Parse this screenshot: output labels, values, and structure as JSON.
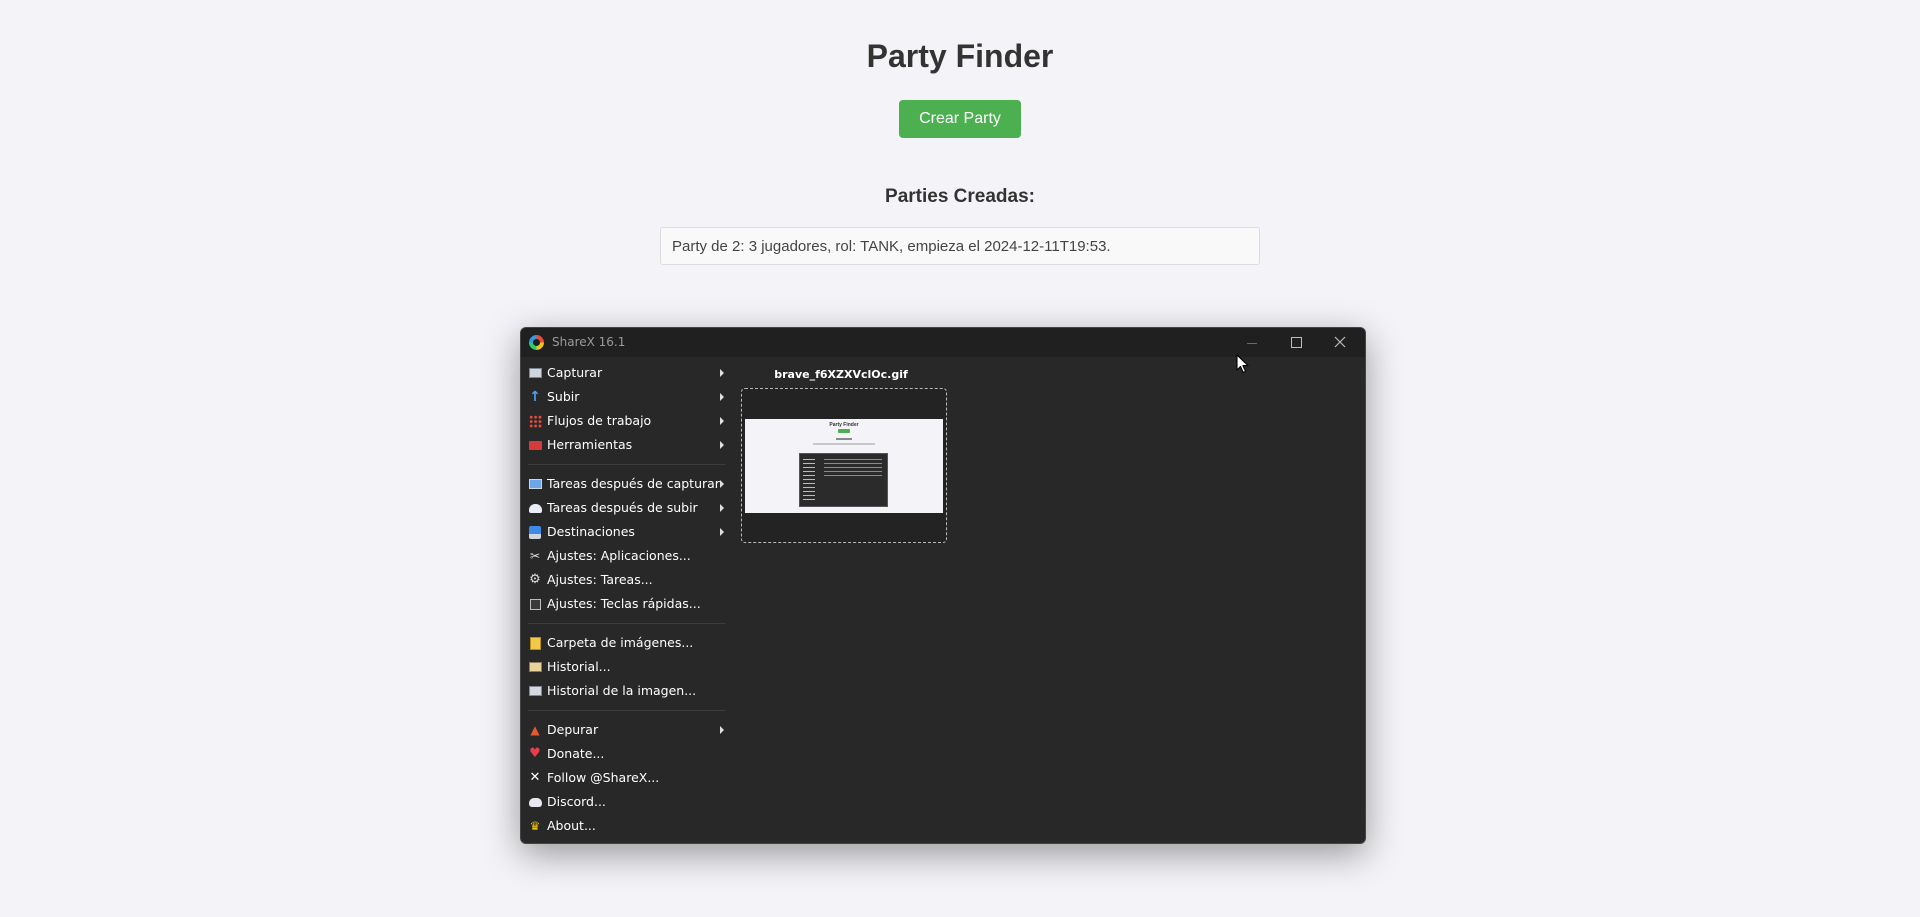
{
  "page": {
    "title": "Party Finder",
    "create_button": "Crear Party",
    "section_title": "Parties Creadas:",
    "parties": [
      "Party de 2: 3 jugadores, rol: TANK, empieza el 2024-12-11T19:53."
    ]
  },
  "sharex": {
    "title": "ShareX 16.1",
    "menu": {
      "capture": "Capturar",
      "upload": "Subir",
      "workflows": "Flujos de trabajo",
      "tools": "Herramientas",
      "after_capture": "Tareas después de capturar",
      "after_upload": "Tareas después de subir",
      "destinations": "Destinaciones",
      "app_settings": "Ajustes: Aplicaciones...",
      "task_settings": "Ajustes: Tareas...",
      "hotkey_settings": "Ajustes: Teclas rápidas...",
      "image_folder": "Carpeta de imágenes...",
      "history": "Historial...",
      "image_history": "Historial de la imagen...",
      "debug": "Depurar",
      "donate": "Donate...",
      "follow": "Follow @ShareX...",
      "discord": "Discord...",
      "about": "About..."
    },
    "file_name": "brave_f6XZXVclOc.gif",
    "thumbnail_title": "Party Finder"
  },
  "colors": {
    "page_background": "#f4f4f8",
    "button_green": "#4caf50",
    "window_background": "#282828",
    "titlebar_background": "#202020"
  },
  "icons": {
    "capture": "capture-icon",
    "upload": "upload-arrow-icon",
    "workflows": "workflow-icon",
    "tools": "tools-icon",
    "after_capture": "after-capture-icon",
    "after_upload": "after-upload-icon",
    "destinations": "destinations-icon",
    "app_settings": "wrench-icon",
    "task_settings": "gear-icon",
    "hotkey_settings": "keyboard-icon",
    "image_folder": "folder-icon",
    "history": "history-icon",
    "image_history": "image-history-icon",
    "debug": "traffic-cone-icon",
    "donate": "heart-icon",
    "follow": "x-logo-icon",
    "discord": "discord-icon",
    "about": "crown-icon"
  }
}
